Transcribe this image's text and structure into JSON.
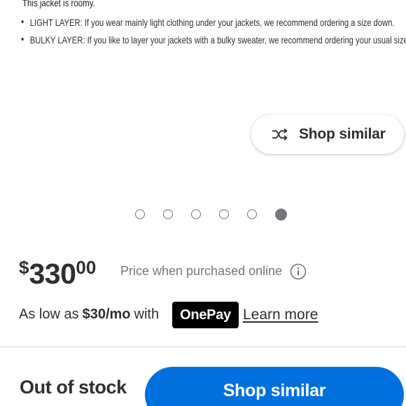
{
  "fit_notes": {
    "intro": "This jacket is roomy.",
    "items": [
      {
        "label": "LIGHT LAYER:",
        "text": "If you wear mainly light clothing under your jackets, we recommend ordering a size down."
      },
      {
        "label": "BULKY LAYER:",
        "text": "If you like to layer your jackets with a bulky sweater, we recommend ordering your usual size."
      }
    ]
  },
  "carousel": {
    "shop_similar_label": "Shop similar",
    "shop_similar_icon": "shuffle-icon",
    "total_slides": 6,
    "active_slide": 6
  },
  "price": {
    "currency": "$",
    "whole": "330",
    "cents": "00",
    "note": "Price when purchased online",
    "info_icon": "info-icon"
  },
  "financing": {
    "prefix": "As low as",
    "amount": "$30/mo",
    "with": "with",
    "provider": "OnePay",
    "learn_more": "Learn more"
  },
  "footer": {
    "status": "Out of stock",
    "cta_label": "Shop similar"
  },
  "colors": {
    "primary_blue": "#0071dc",
    "text": "#2e2f32",
    "muted": "#74767c"
  }
}
